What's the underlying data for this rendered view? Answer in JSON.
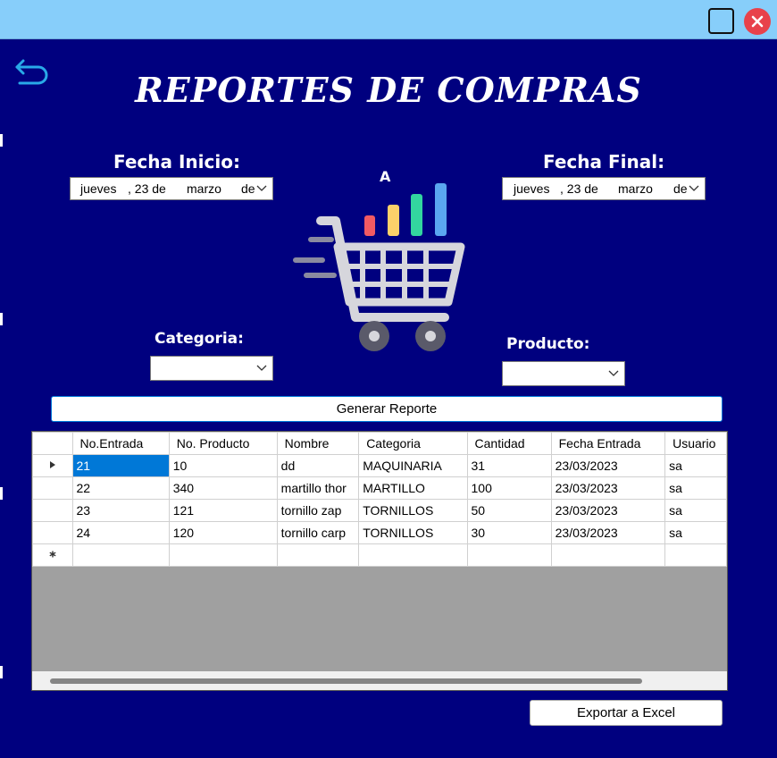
{
  "title": "REPORTES DE COMPRAS",
  "labels": {
    "fecha_inicio": "Fecha Inicio:",
    "fecha_final": "Fecha Final:",
    "separator": "A",
    "categoria": "Categoria:",
    "producto": "Producto:"
  },
  "fecha_inicio": {
    "day_name": "jueves",
    "day": ", 23 de",
    "month": "marzo",
    "tail": "de"
  },
  "fecha_final": {
    "day_name": "jueves",
    "day": ", 23 de",
    "month": "marzo",
    "tail": "de"
  },
  "categoria_value": "",
  "producto_value": "",
  "buttons": {
    "generar": "Generar Reporte",
    "exportar": "Exportar a Excel"
  },
  "grid": {
    "columns": [
      "No.Entrada",
      "No. Producto",
      "Nombre",
      "Categoria",
      "Cantidad",
      "Fecha Entrada",
      "Usuario"
    ],
    "rows": [
      [
        "21",
        "10",
        "dd",
        "MAQUINARIA",
        "31",
        "23/03/2023",
        "sa"
      ],
      [
        "22",
        "340",
        "martillo thor",
        "MARTILLO",
        "100",
        "23/03/2023",
        "sa"
      ],
      [
        "23",
        "121",
        "tornillo zap",
        "TORNILLOS",
        "50",
        "23/03/2023",
        "sa"
      ],
      [
        "24",
        "120",
        "tornillo carp",
        "TORNILLOS",
        "30",
        "23/03/2023",
        "sa"
      ]
    ]
  },
  "icons": {
    "back": "back-arrow-icon",
    "maximize": "maximize-icon",
    "close": "close-icon",
    "cart": "shopping-cart-chart-icon"
  },
  "colors": {
    "background": "#00007f",
    "titlebar": "#87cefa",
    "close": "#e8424b",
    "selection": "#0078d7"
  }
}
